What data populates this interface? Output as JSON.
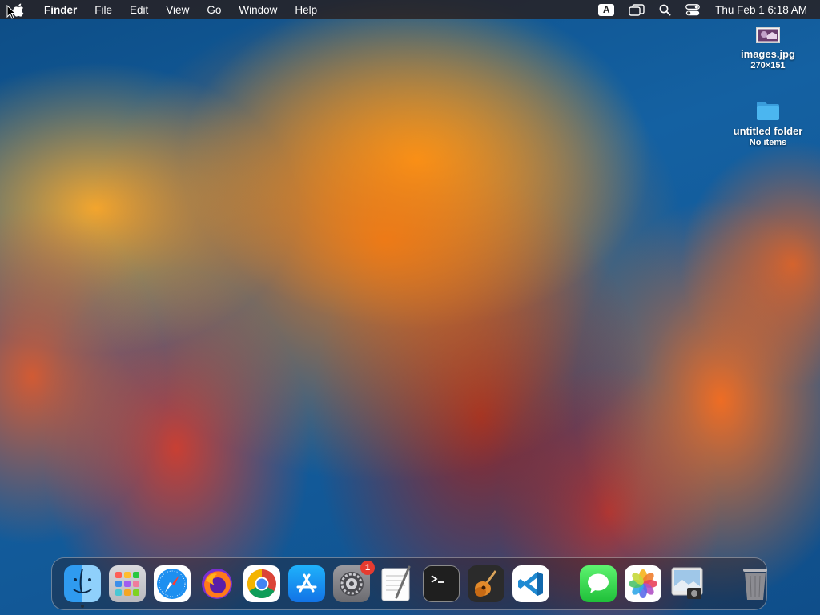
{
  "menubar": {
    "app_name": "Finder",
    "menus": [
      "File",
      "Edit",
      "View",
      "Go",
      "Window",
      "Help"
    ],
    "input_badge": "A",
    "clock": "Thu Feb 1  6:18 AM"
  },
  "desktop_icons": [
    {
      "name": "images.jpg",
      "meta": "270×151"
    },
    {
      "name": "untitled folder",
      "meta": "No items"
    }
  ],
  "dock": {
    "apps": [
      "Finder",
      "Launchpad",
      "Safari",
      "Firefox",
      "Google Chrome",
      "App Store",
      "System Settings",
      "TextEdit",
      "Terminal",
      "GarageBand",
      "Visual Studio Code"
    ],
    "system_settings_badge": "1",
    "recent_apps": [
      "Messages",
      "Photos",
      "Preview"
    ],
    "trash": "Trash"
  },
  "colors": {
    "menubar_bg": "#2a1e1e",
    "badge_red": "#e53b30",
    "folder_blue": "#4bb6f0"
  }
}
